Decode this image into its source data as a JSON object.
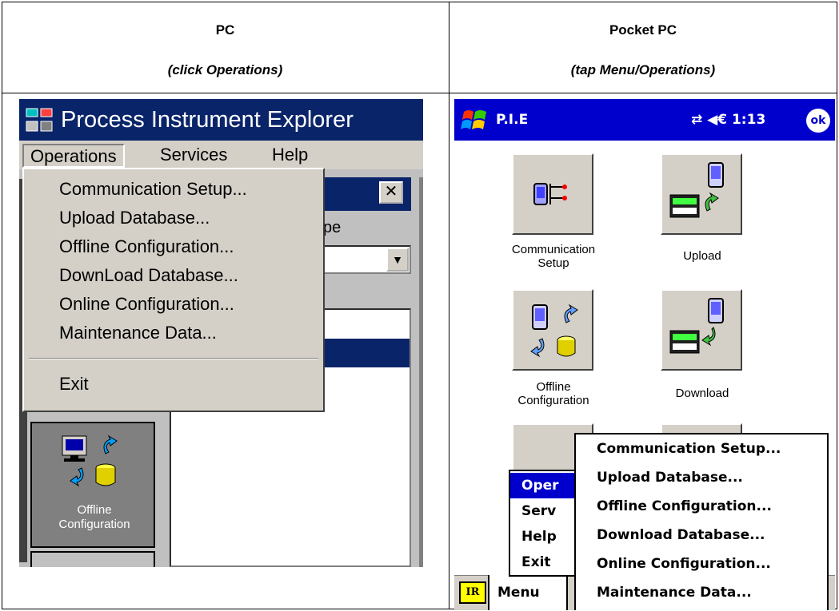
{
  "table": {
    "pc_heading": "PC",
    "pc_subheading": "(click Operations)",
    "ppc_heading": "Pocket PC",
    "ppc_subheading": "(tap Menu/Operations)"
  },
  "pc": {
    "window_title": "Process Instrument Explorer",
    "menubar": [
      "Operations",
      "Services",
      "Help"
    ],
    "dropdown_items": [
      "Communication Setup...",
      "Upload Database...",
      "Offline Configuration...",
      "DownLoad Database...",
      "Online Configuration...",
      "Maintenance Data..."
    ],
    "exit_label": "Exit",
    "background_label_fragment": "pe",
    "close_glyph": "✕",
    "combo_glyph": "▼",
    "side_button_label_line1": "Offline",
    "side_button_label_line2": "Configuration",
    "colors": {
      "titlebar": "#0a246a",
      "face": "#d4d0c8"
    }
  },
  "ppc": {
    "title": "P.I.E",
    "status": "⇄ ◀€ 1:13",
    "ok_label": "ok",
    "tiles": [
      {
        "line1": "Communication",
        "line2": "Setup"
      },
      {
        "line1": "Upload",
        "line2": ""
      },
      {
        "line1": "Offline",
        "line2": "Configuration"
      },
      {
        "line1": "Download",
        "line2": ""
      }
    ],
    "menu_level1": [
      "Oper",
      "Serv",
      "Help",
      "Exit"
    ],
    "menu_level2": [
      "Communication Setup...",
      "Upload Database...",
      "Offline Configuration...",
      "Download Database...",
      "Online Configuration...",
      "Maintenance Data..."
    ],
    "ir_label": "IR",
    "menu_button": "Menu",
    "colors": {
      "titlebar": "#0000cc",
      "ir": "#ffff00"
    }
  }
}
